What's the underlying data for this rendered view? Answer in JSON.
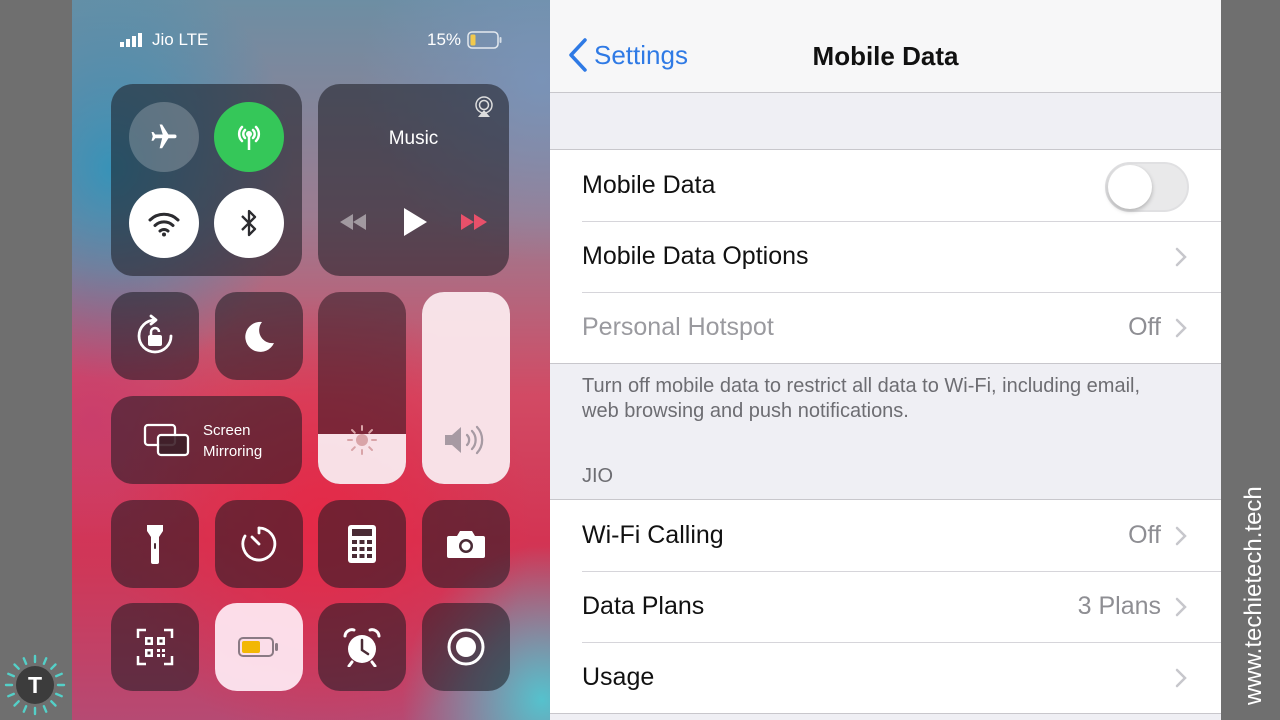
{
  "control_center": {
    "status": {
      "carrier": "Jio LTE",
      "battery": "15%"
    },
    "music": {
      "title": "Music"
    },
    "screen_mirroring": {
      "line1": "Screen",
      "line2": "Mirroring"
    },
    "brightness_level_pct": 26,
    "volume_level_pct": 100,
    "colors": {
      "cellular_on": "#35c759",
      "toggle_on_bg": "#ffffff"
    }
  },
  "settings": {
    "back_label": "Settings",
    "title": "Mobile Data",
    "rows_top": [
      {
        "label": "Mobile Data",
        "toggle_on": false
      },
      {
        "label": "Mobile Data Options"
      },
      {
        "label": "Personal Hotspot",
        "value": "Off"
      }
    ],
    "footnote": "Turn off mobile data to restrict all data to Wi-Fi, including email, web browsing and push notifications.",
    "section_header": "JIO",
    "rows_jio": [
      {
        "label": "Wi-Fi Calling",
        "value": "Off"
      },
      {
        "label": "Data Plans",
        "value": "3 Plans"
      },
      {
        "label": "Usage"
      }
    ],
    "colors": {
      "accent": "#2f7ae5",
      "background": "#efeff4"
    }
  },
  "watermark": "www.techietech.tech",
  "logo_letter": "T"
}
